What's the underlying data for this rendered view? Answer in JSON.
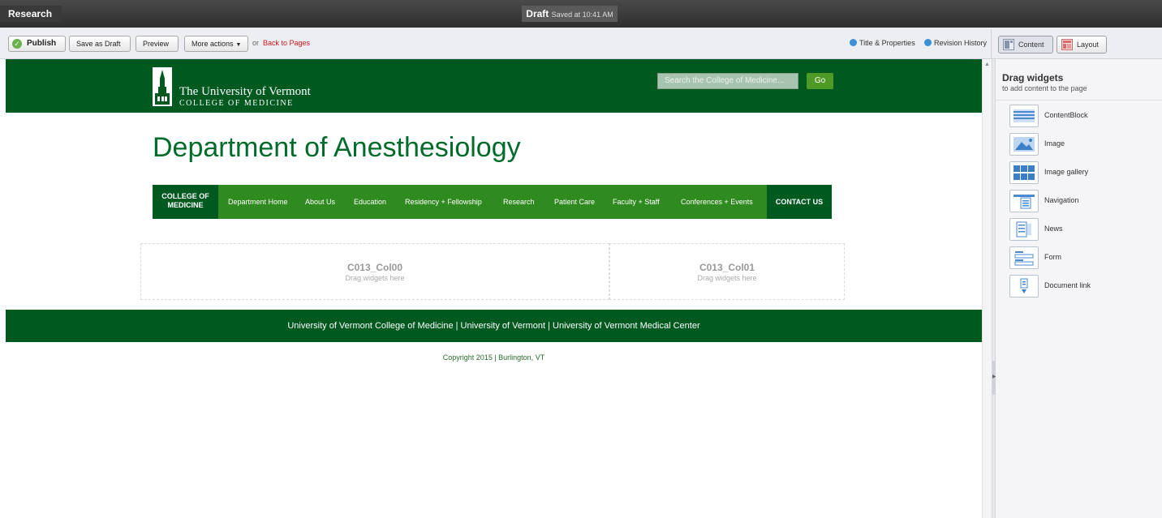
{
  "titlebar": {
    "app_title": "Research",
    "status": "Draft",
    "saved_text": "Saved at 10:41 AM"
  },
  "toolbar": {
    "publish_label": "Publish",
    "save_draft_label": "Save as Draft",
    "preview_label": "Preview",
    "more_actions_label": "More actions",
    "or_text": "or",
    "back_label": "Back to Pages",
    "title_properties_label": "Title & Properties",
    "revision_history_label": "Revision History",
    "content_label": "Content",
    "layout_label": "Layout"
  },
  "site": {
    "logo_name": "The University of Vermont",
    "logo_college": "COLLEGE OF MEDICINE",
    "search_placeholder": "Search the College of Medicine...",
    "go_label": "Go",
    "dept_title": "Department of Anesthesiology",
    "nav": {
      "college_line1": "COLLEGE OF",
      "college_line2": "MEDICINE",
      "items": [
        "Department Home",
        "About Us",
        "Education",
        "Residency + Fellowship",
        "Research",
        "Patient Care",
        "Faculty + Staff",
        "Conferences + Events"
      ],
      "contact": "CONTACT US"
    },
    "zones": [
      {
        "name": "C013_Col00",
        "hint": "Drag widgets here"
      },
      {
        "name": "C013_Col01",
        "hint": "Drag widgets here"
      }
    ],
    "footer_links": "University of Vermont College of Medicine | University of Vermont | University of Vermont Medical Center",
    "copyright": "Copyright 2015 | Burlington, VT"
  },
  "panel": {
    "title": "Drag widgets",
    "subtitle": "to add content to the page",
    "widgets": [
      {
        "label": "ContentBlock",
        "icon": "content-block-icon"
      },
      {
        "label": "Image",
        "icon": "image-icon"
      },
      {
        "label": "Image gallery",
        "icon": "image-gallery-icon"
      },
      {
        "label": "Navigation",
        "icon": "navigation-icon"
      },
      {
        "label": "News",
        "icon": "news-icon"
      },
      {
        "label": "Form",
        "icon": "form-icon"
      },
      {
        "label": "Document link",
        "icon": "document-link-icon"
      }
    ]
  },
  "colors": {
    "brand_green": "#00591f",
    "nav_green": "#2f8a1f",
    "title_green": "#006b2a",
    "link_red": "#d0161f"
  }
}
